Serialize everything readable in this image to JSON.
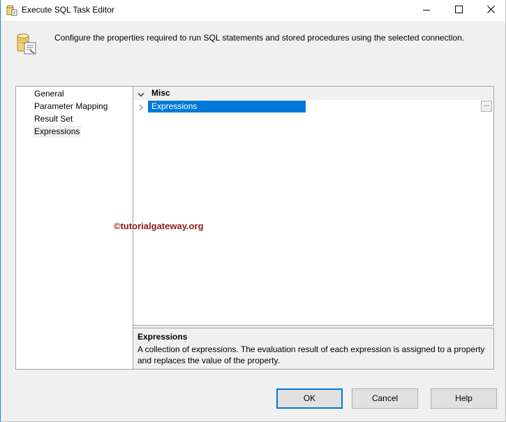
{
  "window": {
    "title": "Execute SQL Task Editor",
    "controls": {
      "minimize_icon": "minimize-icon",
      "maximize_icon": "maximize-icon",
      "close_icon": "close-icon"
    }
  },
  "header": {
    "icon": "sql-task-icon",
    "description": "Configure the properties required to run SQL statements and stored procedures using the selected connection."
  },
  "nav": {
    "items": [
      {
        "label": "General"
      },
      {
        "label": "Parameter Mapping"
      },
      {
        "label": "Result Set"
      },
      {
        "label": "Expressions",
        "selected": true
      }
    ]
  },
  "property_grid": {
    "category": "Misc",
    "properties": [
      {
        "name": "Expressions",
        "value": "",
        "has_ellipsis": true,
        "ellipsis_label": "..."
      }
    ]
  },
  "watermark": "©tutorialgateway.org",
  "description_panel": {
    "title": "Expressions",
    "text": "A collection of expressions. The evaluation result of each expression is assigned to a property and replaces the value of the property."
  },
  "buttons": {
    "ok": "OK",
    "cancel": "Cancel",
    "help": "Help"
  },
  "colors": {
    "selection": "#0078d7",
    "window_bg": "#f0f0f0",
    "watermark": "#8b1a1a"
  }
}
